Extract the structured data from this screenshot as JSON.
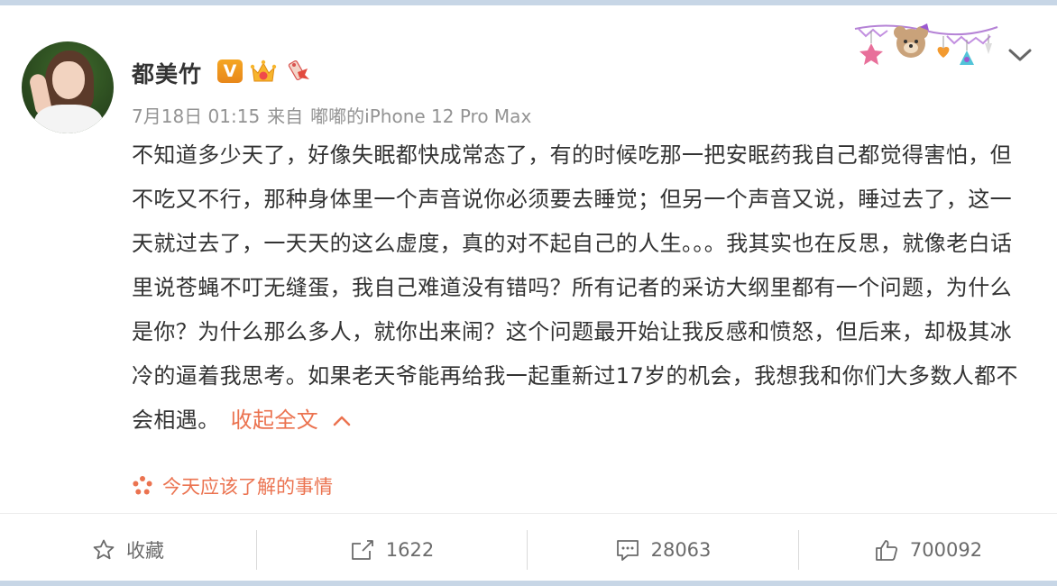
{
  "post": {
    "author": {
      "name": "都美竹",
      "badge_text": "V"
    },
    "meta": {
      "date": "7月18日 01:15",
      "source_prefix": "来自",
      "device": "嘟嘟的iPhone 12 Pro Max"
    },
    "text": "不知道多少天了，好像失眠都快成常态了，有的时候吃那一把安眠药我自己都觉得害怕，但不吃又不行，那种身体里一个声音说你必须要去睡觉；但另一个声音又说，睡过去了，这一天就过去了，一天天的这么虚度，真的对不起自己的人生。。。我其实也在反思，就像老白话里说苍蝇不叮无缝蛋，我自己难道没有错吗？所有记者的采访大纲里都有一个问题，为什么是你？为什么那么多人，就你出来闹？这个问题最开始让我反感和愤怒，但后来，却极其冰冷的逼着我思考。如果老天爷能再给我一起重新过17岁的机会，我想我和你们大多数人都不会相遇。",
    "collapse_label": "收起全文",
    "topic_label": "今天应该了解的事情"
  },
  "actions": {
    "favorite_label": "收藏",
    "repost_count": "1622",
    "comment_count": "28063",
    "like_count": "700092"
  },
  "colors": {
    "accent": "#eb7350",
    "vip": "#f5a623",
    "text": "#333333",
    "meta": "#939393",
    "icon": "#6b6b6b"
  },
  "icons": {
    "more": "chevron-down-icon",
    "favorite": "star-icon",
    "repost": "share-icon",
    "comment": "comment-icon",
    "like": "thumbs-up-icon",
    "topic": "flower-icon"
  }
}
